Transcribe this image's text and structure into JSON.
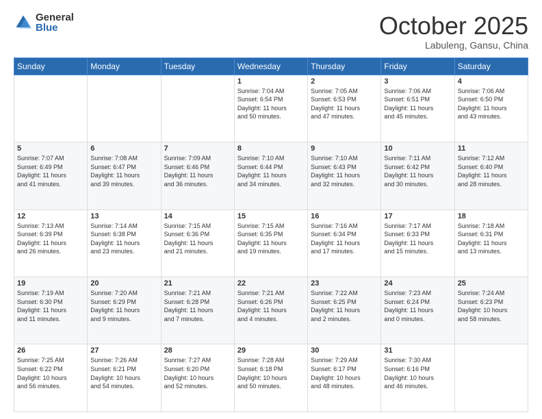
{
  "header": {
    "logo_general": "General",
    "logo_blue": "Blue",
    "month": "October 2025",
    "location": "Labuleng, Gansu, China"
  },
  "weekdays": [
    "Sunday",
    "Monday",
    "Tuesday",
    "Wednesday",
    "Thursday",
    "Friday",
    "Saturday"
  ],
  "weeks": [
    [
      {
        "day": "",
        "info": ""
      },
      {
        "day": "",
        "info": ""
      },
      {
        "day": "",
        "info": ""
      },
      {
        "day": "1",
        "info": "Sunrise: 7:04 AM\nSunset: 6:54 PM\nDaylight: 11 hours\nand 50 minutes."
      },
      {
        "day": "2",
        "info": "Sunrise: 7:05 AM\nSunset: 6:53 PM\nDaylight: 11 hours\nand 47 minutes."
      },
      {
        "day": "3",
        "info": "Sunrise: 7:06 AM\nSunset: 6:51 PM\nDaylight: 11 hours\nand 45 minutes."
      },
      {
        "day": "4",
        "info": "Sunrise: 7:06 AM\nSunset: 6:50 PM\nDaylight: 11 hours\nand 43 minutes."
      }
    ],
    [
      {
        "day": "5",
        "info": "Sunrise: 7:07 AM\nSunset: 6:49 PM\nDaylight: 11 hours\nand 41 minutes."
      },
      {
        "day": "6",
        "info": "Sunrise: 7:08 AM\nSunset: 6:47 PM\nDaylight: 11 hours\nand 39 minutes."
      },
      {
        "day": "7",
        "info": "Sunrise: 7:09 AM\nSunset: 6:46 PM\nDaylight: 11 hours\nand 36 minutes."
      },
      {
        "day": "8",
        "info": "Sunrise: 7:10 AM\nSunset: 6:44 PM\nDaylight: 11 hours\nand 34 minutes."
      },
      {
        "day": "9",
        "info": "Sunrise: 7:10 AM\nSunset: 6:43 PM\nDaylight: 11 hours\nand 32 minutes."
      },
      {
        "day": "10",
        "info": "Sunrise: 7:11 AM\nSunset: 6:42 PM\nDaylight: 11 hours\nand 30 minutes."
      },
      {
        "day": "11",
        "info": "Sunrise: 7:12 AM\nSunset: 6:40 PM\nDaylight: 11 hours\nand 28 minutes."
      }
    ],
    [
      {
        "day": "12",
        "info": "Sunrise: 7:13 AM\nSunset: 6:39 PM\nDaylight: 11 hours\nand 26 minutes."
      },
      {
        "day": "13",
        "info": "Sunrise: 7:14 AM\nSunset: 6:38 PM\nDaylight: 11 hours\nand 23 minutes."
      },
      {
        "day": "14",
        "info": "Sunrise: 7:15 AM\nSunset: 6:36 PM\nDaylight: 11 hours\nand 21 minutes."
      },
      {
        "day": "15",
        "info": "Sunrise: 7:15 AM\nSunset: 6:35 PM\nDaylight: 11 hours\nand 19 minutes."
      },
      {
        "day": "16",
        "info": "Sunrise: 7:16 AM\nSunset: 6:34 PM\nDaylight: 11 hours\nand 17 minutes."
      },
      {
        "day": "17",
        "info": "Sunrise: 7:17 AM\nSunset: 6:33 PM\nDaylight: 11 hours\nand 15 minutes."
      },
      {
        "day": "18",
        "info": "Sunrise: 7:18 AM\nSunset: 6:31 PM\nDaylight: 11 hours\nand 13 minutes."
      }
    ],
    [
      {
        "day": "19",
        "info": "Sunrise: 7:19 AM\nSunset: 6:30 PM\nDaylight: 11 hours\nand 11 minutes."
      },
      {
        "day": "20",
        "info": "Sunrise: 7:20 AM\nSunset: 6:29 PM\nDaylight: 11 hours\nand 9 minutes."
      },
      {
        "day": "21",
        "info": "Sunrise: 7:21 AM\nSunset: 6:28 PM\nDaylight: 11 hours\nand 7 minutes."
      },
      {
        "day": "22",
        "info": "Sunrise: 7:21 AM\nSunset: 6:26 PM\nDaylight: 11 hours\nand 4 minutes."
      },
      {
        "day": "23",
        "info": "Sunrise: 7:22 AM\nSunset: 6:25 PM\nDaylight: 11 hours\nand 2 minutes."
      },
      {
        "day": "24",
        "info": "Sunrise: 7:23 AM\nSunset: 6:24 PM\nDaylight: 11 hours\nand 0 minutes."
      },
      {
        "day": "25",
        "info": "Sunrise: 7:24 AM\nSunset: 6:23 PM\nDaylight: 10 hours\nand 58 minutes."
      }
    ],
    [
      {
        "day": "26",
        "info": "Sunrise: 7:25 AM\nSunset: 6:22 PM\nDaylight: 10 hours\nand 56 minutes."
      },
      {
        "day": "27",
        "info": "Sunrise: 7:26 AM\nSunset: 6:21 PM\nDaylight: 10 hours\nand 54 minutes."
      },
      {
        "day": "28",
        "info": "Sunrise: 7:27 AM\nSunset: 6:20 PM\nDaylight: 10 hours\nand 52 minutes."
      },
      {
        "day": "29",
        "info": "Sunrise: 7:28 AM\nSunset: 6:18 PM\nDaylight: 10 hours\nand 50 minutes."
      },
      {
        "day": "30",
        "info": "Sunrise: 7:29 AM\nSunset: 6:17 PM\nDaylight: 10 hours\nand 48 minutes."
      },
      {
        "day": "31",
        "info": "Sunrise: 7:30 AM\nSunset: 6:16 PM\nDaylight: 10 hours\nand 46 minutes."
      },
      {
        "day": "",
        "info": ""
      }
    ]
  ]
}
